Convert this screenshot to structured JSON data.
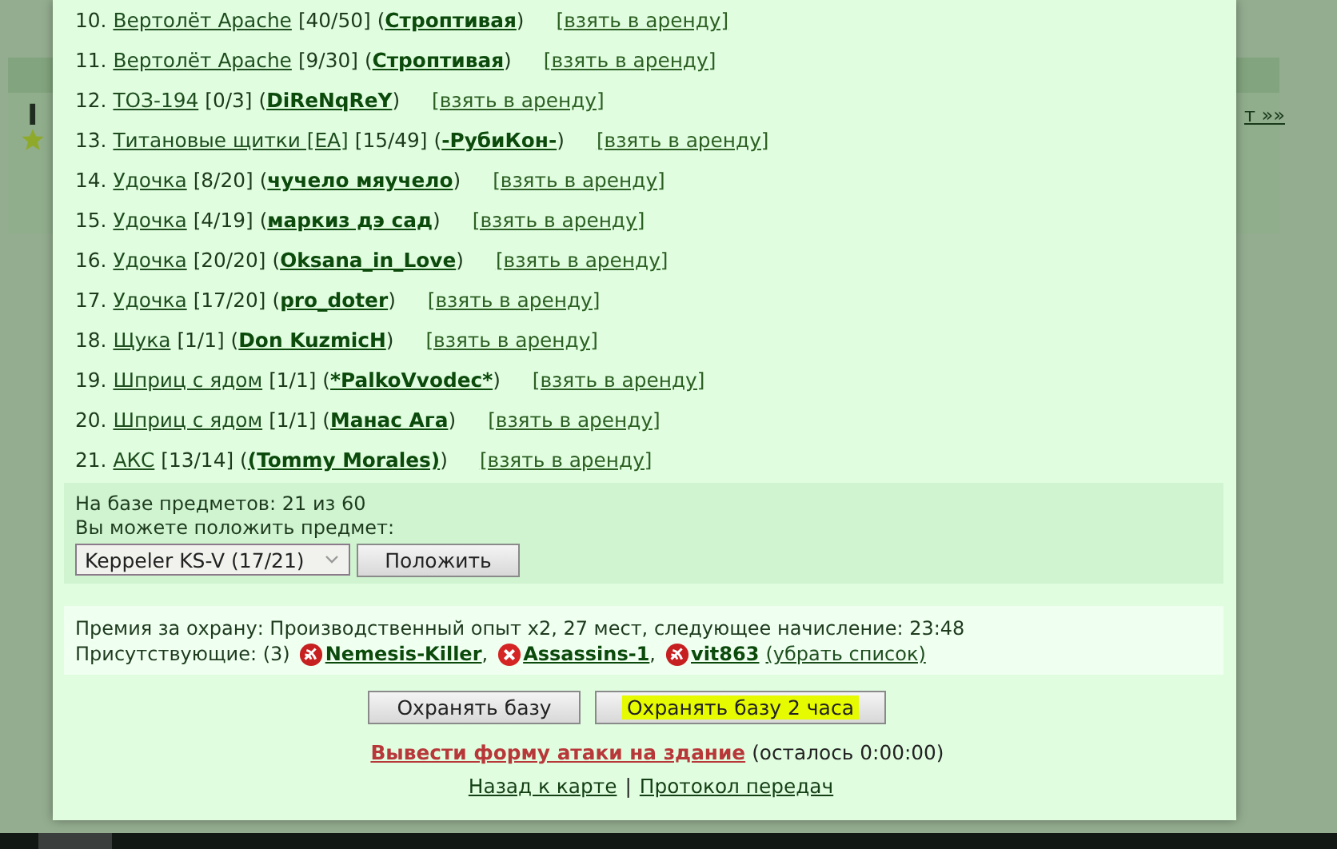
{
  "background_page": {
    "heading_fragment": "I",
    "link_fragment": "т »»"
  },
  "items": [
    {
      "number": "10.",
      "item": "Вертолёт Apache",
      "count": "[40/50]",
      "open": "(",
      "owner": "Строптивая",
      "close": ")",
      "action": "[взять в аренду]"
    },
    {
      "number": "11.",
      "item": "Вертолёт Apache",
      "count": "[9/30]",
      "open": "(",
      "owner": "Строптивая",
      "close": ")",
      "action": "[взять в аренду]"
    },
    {
      "number": "12.",
      "item": "ТОЗ-194",
      "count": "[0/3]",
      "open": "(",
      "owner": "DiReNqReY",
      "close": ")",
      "action": "[взять в аренду]"
    },
    {
      "number": "13.",
      "item": "Титановые щитки [EA]",
      "count": "[15/49]",
      "open": "(",
      "owner": "-РубиКон-",
      "close": ")",
      "action": "[взять в аренду]"
    },
    {
      "number": "14.",
      "item": "Удочка",
      "count": "[8/20]",
      "open": "(",
      "owner": "чучело мяучело",
      "close": ")",
      "action": "[взять в аренду]"
    },
    {
      "number": "15.",
      "item": "Удочка",
      "count": "[4/19]",
      "open": "(",
      "owner": "маркиз дэ сад",
      "close": ")",
      "action": "[взять в аренду]"
    },
    {
      "number": "16.",
      "item": "Удочка",
      "count": "[20/20]",
      "open": "(",
      "owner": "Oksana_in_Love",
      "close": ")",
      "action": "[взять в аренду]"
    },
    {
      "number": "17.",
      "item": "Удочка",
      "count": "[17/20]",
      "open": "(",
      "owner": "pro_doter",
      "close": ")",
      "action": "[взять в аренду]"
    },
    {
      "number": "18.",
      "item": "Щука",
      "count": "[1/1]",
      "open": "(",
      "owner": "Don KuzmicH",
      "close": ")",
      "action": "[взять в аренду]"
    },
    {
      "number": "19.",
      "item": "Шприц с ядом",
      "count": "[1/1]",
      "open": "(",
      "owner": "*PalkoVvodec*",
      "close": ")",
      "action": "[взять в аренду]"
    },
    {
      "number": "20.",
      "item": "Шприц с ядом",
      "count": "[1/1]",
      "open": "(",
      "owner": "Манас Ага",
      "close": ")",
      "action": "[взять в аренду]"
    },
    {
      "number": "21.",
      "item": "АКС",
      "count": "[13/14]",
      "open": "(",
      "owner": "(Tommy Morales)",
      "close": ")",
      "action": "[взять в аренду]"
    }
  ],
  "storage": {
    "capacity": "На базе предметов: 21 из 60",
    "prompt": "Вы можете положить предмет:",
    "select_value": "Keppeler KS-V (17/21)",
    "button": "Положить"
  },
  "guard": {
    "reward": "Премия за охрану: Производственный опыт x2, 27 мест, следующее начисление: 23:48",
    "present_label": "Присутствующие: (3)",
    "present": [
      {
        "kind": "broken",
        "name": "Nemesis-Killer",
        "separator": ","
      },
      {
        "kind": "cross",
        "name": "Assassins-1",
        "separator": ","
      },
      {
        "kind": "broken",
        "name": "vit863"
      }
    ],
    "hide_link": "(убрать список)"
  },
  "buttons": [
    {
      "label": "Охранять базу",
      "highlighted": false
    },
    {
      "label": "Охранять базу 2 часа",
      "highlighted": true
    }
  ],
  "attack": {
    "link": "Вывести форму атаки на здание",
    "remaining": "(осталось 0:00:00)"
  },
  "footer": {
    "links": [
      "Назад к карте",
      "Протокол передач"
    ],
    "separator": "|"
  }
}
